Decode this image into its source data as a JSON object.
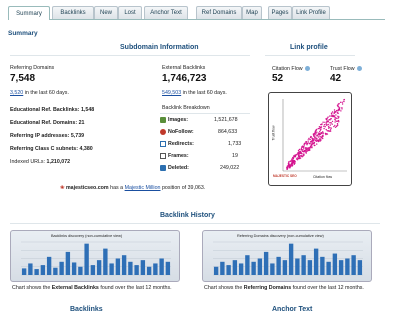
{
  "tabs": [
    {
      "label": "Summary"
    },
    {
      "label": "Backlinks"
    },
    {
      "label": "New"
    },
    {
      "label": "Lost"
    },
    {
      "label": "Anchor Text"
    },
    {
      "label": "Ref Domains"
    },
    {
      "label": "Map"
    },
    {
      "label": "Pages"
    },
    {
      "label": "Link Profile"
    }
  ],
  "summary": {
    "title": "Summary",
    "subdomain_title": "Subdomain Information",
    "link_profile_title": "Link profile",
    "referring_domains_label": "Referring Domains",
    "referring_domains_value": "7,548",
    "ref_domains_recent_link": "3,520",
    "ref_domains_recent_text": "in the last 60 days.",
    "external_backlinks_label": "External Backlinks",
    "external_backlinks_value": "1,746,723",
    "ext_backlinks_recent_link": "549,503",
    "ext_backlinks_recent_text": "in the last 60 days.",
    "citation_flow_label": "Citation Flow",
    "citation_flow_value": "52",
    "trust_flow_label": "Trust Flow",
    "trust_flow_value": "42",
    "stats": [
      {
        "label": "Educational Ref. Backlinks:",
        "value": "1,548"
      },
      {
        "label": "Educational Ref. Domains:",
        "value": "21"
      },
      {
        "label": "Referring IP addresses:",
        "value": "5,739"
      },
      {
        "label": "Referring Class C subnets:",
        "value": "4,380"
      },
      {
        "label": "Indexed URLs:",
        "value": "1,210,072"
      }
    ],
    "breakdown_title": "Backlink Breakdown",
    "breakdown": [
      {
        "label": "Images:",
        "value": "1,521,678",
        "icon": "image-icon",
        "color": "#5a8f3a"
      },
      {
        "label": "NoFollow:",
        "value": "864,633",
        "icon": "nofollow-icon",
        "color": "#c0392b"
      },
      {
        "label": "Redirects:",
        "value": "1,733",
        "icon": "redirect-icon",
        "color": "#2c6fb0"
      },
      {
        "label": "Frames:",
        "value": "19",
        "icon": "frame-icon",
        "color": "#555555"
      },
      {
        "label": "Deleted:",
        "value": "249,022",
        "icon": "deleted-icon",
        "color": "#2c6fb0"
      }
    ],
    "million_site": "majesticseo.com",
    "million_text_a": "has a",
    "million_link": "Majestic Million",
    "million_text_b": "position of 39,063.",
    "scatter_xlabel": "Citation flow",
    "scatter_ylabel": "Trust flow",
    "scatter_logo": "MAJESTIC SEO"
  },
  "history": {
    "title": "Backlink History",
    "left_chart_title": "Backlinks discovery (non-cumulative view)",
    "right_chart_title": "Referring Domains discovery (non-cumulative view)",
    "left_caption_a": "Chart shows the",
    "left_caption_b": "External Backlinks",
    "left_caption_c": "found over the last 12 months.",
    "right_caption_a": "Chart shows the",
    "right_caption_b": "Referring Domains",
    "right_caption_c": "found over the last 12 months."
  },
  "footer": {
    "backlinks_title": "Backlinks",
    "anchor_title": "Anchor Text"
  },
  "colors": {
    "accent": "#1d4f7c",
    "bar": "#2e6fb6",
    "scatter": "#d4148f"
  },
  "chart_data": [
    {
      "type": "bar",
      "title": "Backlinks discovery (non-cumulative view)",
      "categories": [
        "1",
        "2",
        "3",
        "4",
        "5",
        "6",
        "7",
        "8",
        "9",
        "10",
        "11",
        "12",
        "13",
        "14",
        "15",
        "16",
        "17",
        "18",
        "19",
        "20",
        "21",
        "22",
        "23",
        "24"
      ],
      "values": [
        20,
        35,
        18,
        30,
        55,
        22,
        40,
        70,
        38,
        25,
        95,
        30,
        45,
        80,
        35,
        50,
        60,
        40,
        30,
        45,
        25,
        35,
        50,
        40
      ],
      "ylim": [
        0,
        100
      ]
    },
    {
      "type": "bar",
      "title": "Referring Domains discovery (non-cumulative view)",
      "categories": [
        "1",
        "2",
        "3",
        "4",
        "5",
        "6",
        "7",
        "8",
        "9",
        "10",
        "11",
        "12",
        "13",
        "14",
        "15",
        "16",
        "17",
        "18",
        "19",
        "20",
        "21",
        "22",
        "23",
        "24"
      ],
      "values": [
        25,
        40,
        30,
        45,
        35,
        60,
        40,
        50,
        70,
        35,
        55,
        45,
        95,
        50,
        60,
        45,
        80,
        55,
        40,
        65,
        45,
        50,
        60,
        45
      ],
      "ylim": [
        0,
        100
      ]
    }
  ]
}
